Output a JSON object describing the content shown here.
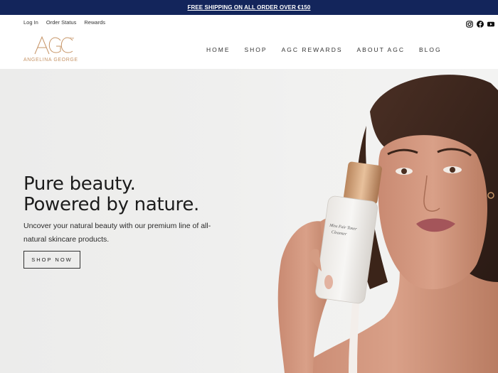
{
  "announcement": {
    "text": "FREE SHIPPING ON ALL ORDER OVER €150"
  },
  "utility": {
    "links": [
      "Log In",
      "Order Status",
      "Rewards"
    ],
    "social": [
      "instagram-icon",
      "facebook-icon",
      "youtube-icon"
    ]
  },
  "brand": {
    "mark": "AGC",
    "trademark": "TM",
    "wordmark": "ANGELINA GEORGE",
    "color": "#c69466"
  },
  "nav": {
    "items": [
      "HOME",
      "SHOP",
      "AGC REWARDS",
      "ABOUT AGC",
      "BLOG"
    ]
  },
  "hero": {
    "headline_line1": "Pure beauty.",
    "headline_line2": "Powered by nature.",
    "subtext": "Uncover your natural beauty with our premium line of all-natural skincare products.",
    "cta_label": "SHOP NOW",
    "bottle_label": "Miss Fair Toner Cleanser"
  },
  "colors": {
    "announcement_bg": "#13255b",
    "accent": "#c69466"
  }
}
